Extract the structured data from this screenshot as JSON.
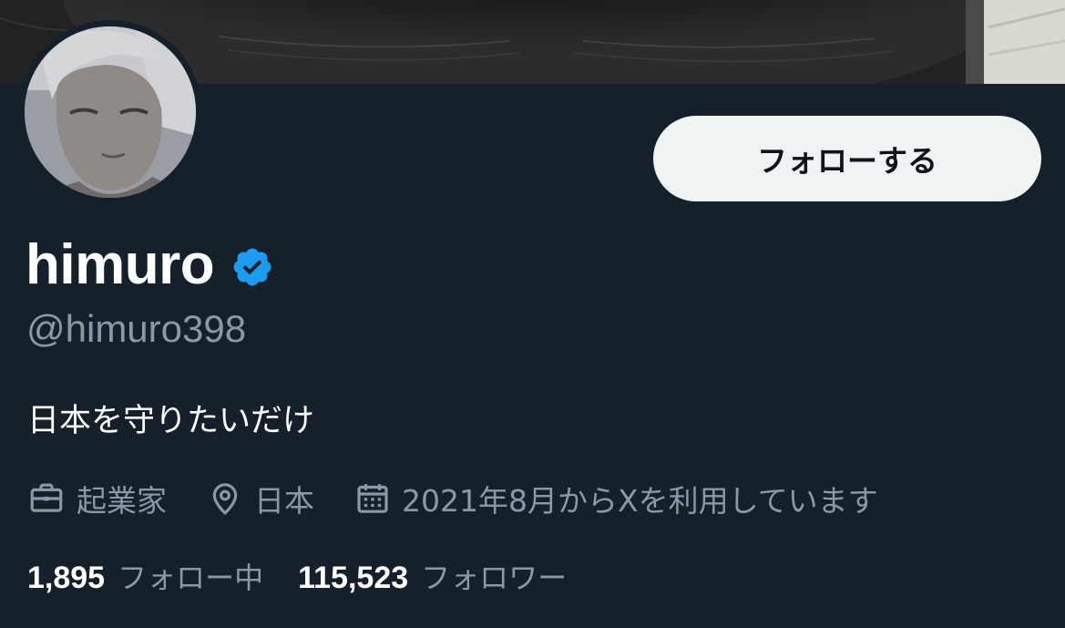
{
  "profile": {
    "display_name": "himuro",
    "handle": "@himuro398",
    "bio": "日本を守りたいだけ",
    "verified_badge_icon": "verified-badge-icon",
    "verified_color": "#1d9bf0"
  },
  "actions": {
    "follow_label": "フォローする"
  },
  "meta": {
    "profession": "起業家",
    "location": "日本",
    "joined": "2021年8月からXを利用しています"
  },
  "stats": {
    "following_count": "1,895",
    "following_label": "フォロー中",
    "followers_count": "115,523",
    "followers_label": "フォロワー"
  },
  "colors": {
    "background": "#15202b",
    "primary_text": "#ffffff",
    "secondary_text": "#8b98a5",
    "button_bg": "#eff3f4",
    "button_text": "#0f1419"
  }
}
